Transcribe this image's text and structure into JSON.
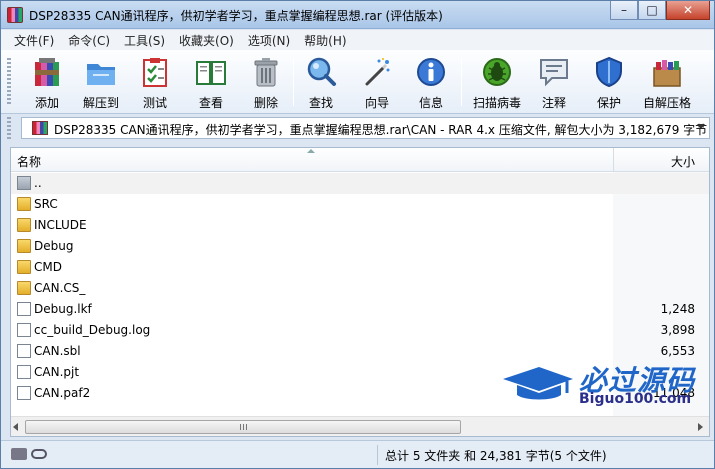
{
  "window": {
    "title": "DSP28335 CAN通讯程序，供初学者学习，重点掌握编程思想.rar (评估版本)",
    "controls": {
      "minimize": "–",
      "maximize": "□",
      "close": "✕"
    }
  },
  "menu": {
    "items": [
      "文件(F)",
      "命令(C)",
      "工具(S)",
      "收藏夹(O)",
      "选项(N)",
      "帮助(H)"
    ]
  },
  "toolbar": {
    "buttons": [
      {
        "label": "添加",
        "icon": "add-archive-icon"
      },
      {
        "label": "解压到",
        "icon": "extract-folder-icon"
      },
      {
        "label": "测试",
        "icon": "test-checklist-icon"
      },
      {
        "label": "查看",
        "icon": "view-book-icon"
      },
      {
        "label": "删除",
        "icon": "trash-icon"
      },
      {
        "label": "查找",
        "icon": "magnifier-icon"
      },
      {
        "label": "向导",
        "icon": "wizard-wand-icon"
      },
      {
        "label": "信息",
        "icon": "info-icon"
      },
      {
        "label": "扫描病毒",
        "icon": "virus-bug-icon"
      },
      {
        "label": "注释",
        "icon": "comment-icon"
      },
      {
        "label": "保护",
        "icon": "shield-icon"
      },
      {
        "label": "自解压格",
        "icon": "sfx-box-icon"
      }
    ]
  },
  "pathbar": {
    "text": "DSP28335 CAN通讯程序，供初学者学习，重点掌握编程思想.rar\\CAN - RAR 4.x 压缩文件, 解包大小为 3,182,679 字节"
  },
  "columns": {
    "name": "名称",
    "size": "大小"
  },
  "files": [
    {
      "name": "..",
      "size": "",
      "type": "up"
    },
    {
      "name": "SRC",
      "size": "",
      "type": "folder"
    },
    {
      "name": "INCLUDE",
      "size": "",
      "type": "folder"
    },
    {
      "name": "Debug",
      "size": "",
      "type": "folder"
    },
    {
      "name": "CMD",
      "size": "",
      "type": "folder"
    },
    {
      "name": "CAN.CS_",
      "size": "",
      "type": "folder"
    },
    {
      "name": "Debug.lkf",
      "size": "1,248",
      "type": "file"
    },
    {
      "name": "cc_build_Debug.log",
      "size": "3,898",
      "type": "file"
    },
    {
      "name": "CAN.sbl",
      "size": "6,553",
      "type": "file"
    },
    {
      "name": "CAN.pjt",
      "size": "",
      "type": "file"
    },
    {
      "name": "CAN.paf2",
      "size": "11,048",
      "type": "file"
    }
  ],
  "status": {
    "text": "总计 5 文件夹 和 24,381 字节(5 个文件)"
  },
  "watermark": {
    "title": "必过源码",
    "url": "Biguo100.com"
  },
  "colors": {
    "folder": "#e4ae2b",
    "watermark_blue": "#1f66c8",
    "title_bar": "#a9c6e8"
  }
}
